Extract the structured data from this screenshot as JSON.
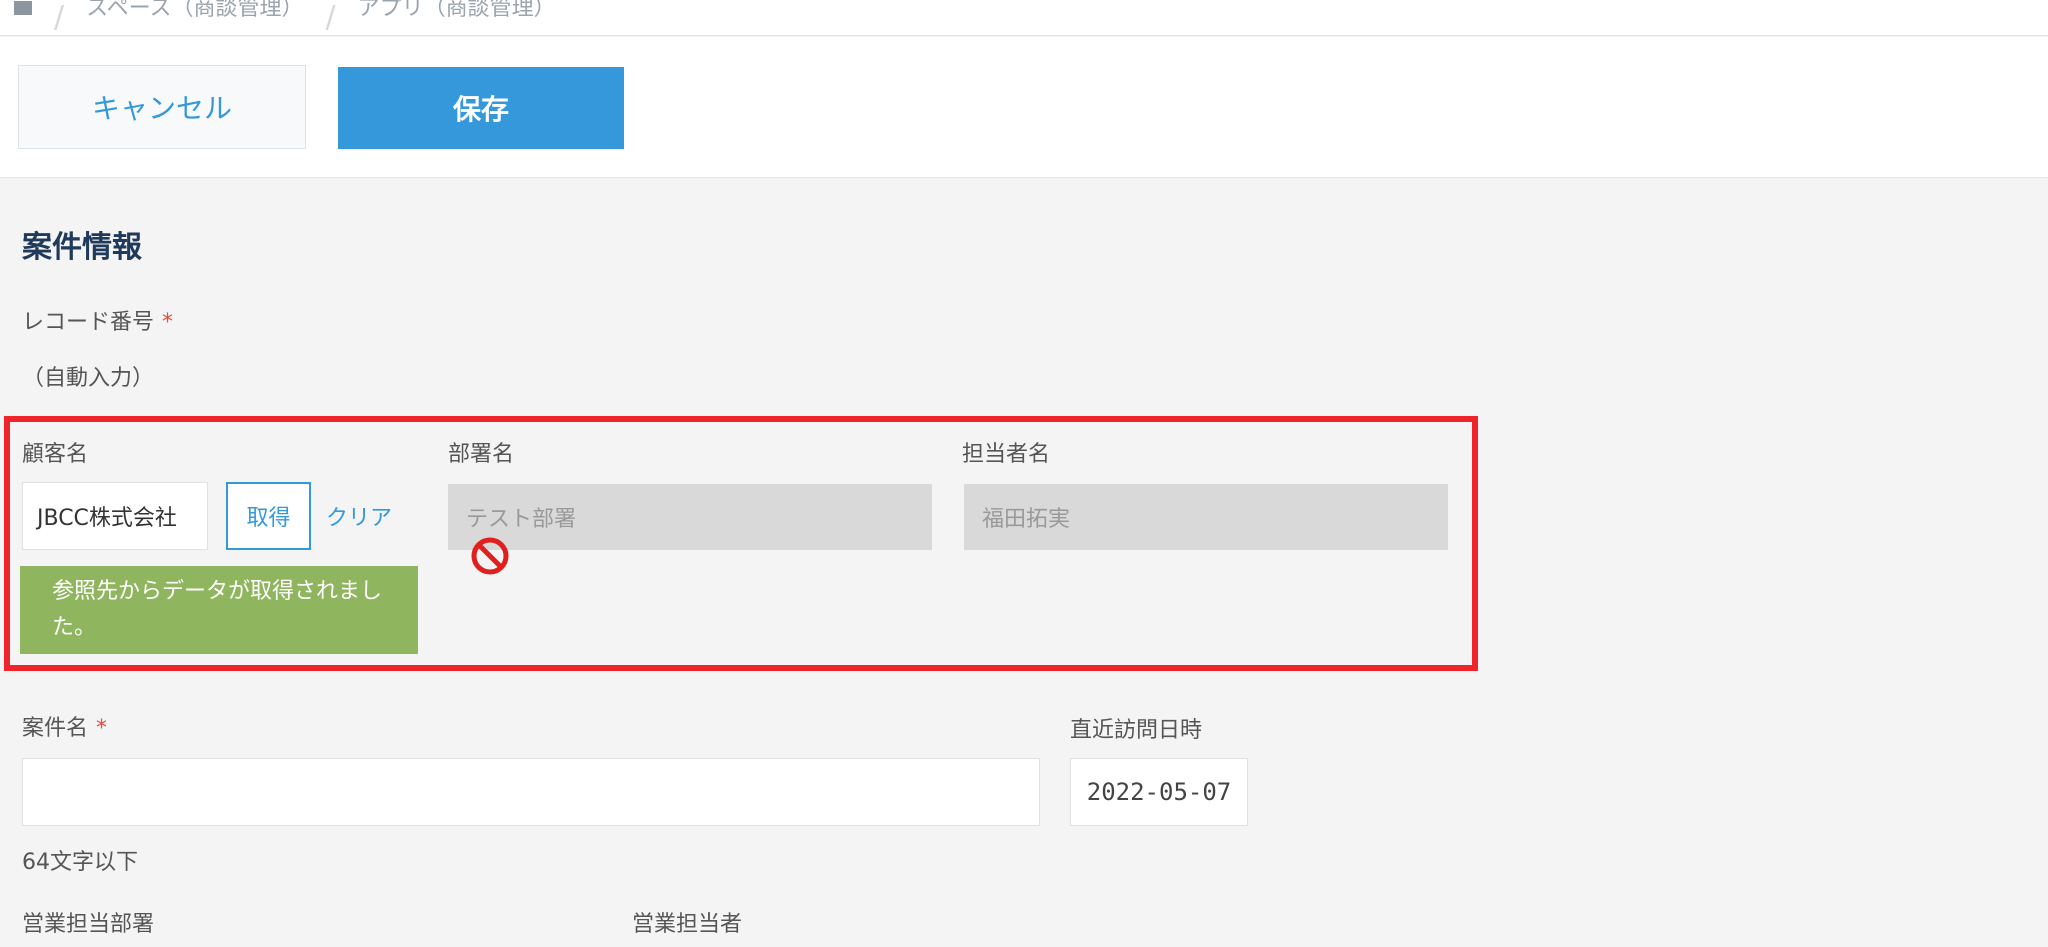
{
  "breadcrumb": {
    "items": [
      "スペース（商談管理）",
      "アプリ（商談管理）"
    ]
  },
  "toolbar": {
    "cancel_label": "キャンセル",
    "save_label": "保存"
  },
  "section": {
    "title": "案件情報"
  },
  "record_number": {
    "label": "レコード番号",
    "required_mark": "*",
    "value": "（自動入力）"
  },
  "lookup": {
    "customer": {
      "label": "顧客名",
      "value": "JBCC株式会社",
      "fetch_label": "取得",
      "clear_label": "クリア"
    },
    "department": {
      "label": "部署名",
      "value": "テスト部署"
    },
    "person": {
      "label": "担当者名",
      "value": "福田拓実"
    },
    "message": "参照先からデータが取得されました。"
  },
  "case_name": {
    "label": "案件名",
    "required_mark": "*",
    "value": "",
    "hint": "64文字以下"
  },
  "last_visit": {
    "label": "直近訪問日時",
    "value": "2022-05-07"
  },
  "sales_dept": {
    "label": "営業担当部署"
  },
  "sales_person": {
    "label": "営業担当者"
  },
  "colors": {
    "accent": "#3498db",
    "success": "#8fb55e",
    "highlight": "#f0252b",
    "required": "#e74c3c"
  }
}
